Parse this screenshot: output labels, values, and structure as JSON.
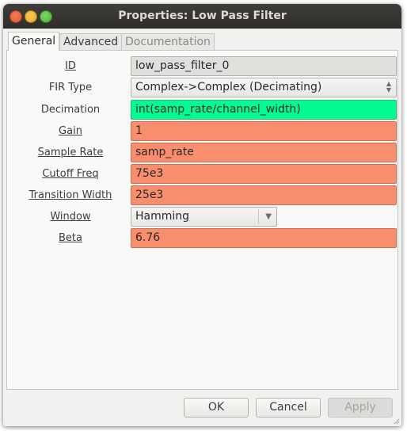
{
  "window": {
    "title": "Properties: Low Pass Filter"
  },
  "tabs": [
    {
      "label": "General",
      "state": "active"
    },
    {
      "label": "Advanced",
      "state": "normal"
    },
    {
      "label": "Documentation",
      "state": "disabled"
    }
  ],
  "params": {
    "id": {
      "label": "ID",
      "value": "low_pass_filter_0"
    },
    "fir_type": {
      "label": "FIR Type",
      "value": "Complex->Complex (Decimating)"
    },
    "decimation": {
      "label": "Decimation",
      "value": "int(samp_rate/channel_width)"
    },
    "gain": {
      "label": "Gain",
      "value": "1"
    },
    "sample_rate": {
      "label": "Sample Rate",
      "value": "samp_rate"
    },
    "cutoff_freq": {
      "label": "Cutoff Freq",
      "value": "75e3"
    },
    "transition_width": {
      "label": "Transition Width",
      "value": "25e3"
    },
    "window": {
      "label": "Window",
      "value": "Hamming"
    },
    "beta": {
      "label": "Beta",
      "value": "6.76"
    }
  },
  "buttons": {
    "ok": "OK",
    "cancel": "Cancel",
    "apply": "Apply"
  },
  "colors": {
    "editable_field": "#f98e6e",
    "expression_field": "#03fb92",
    "readonly_field": "#e0dfdd"
  }
}
